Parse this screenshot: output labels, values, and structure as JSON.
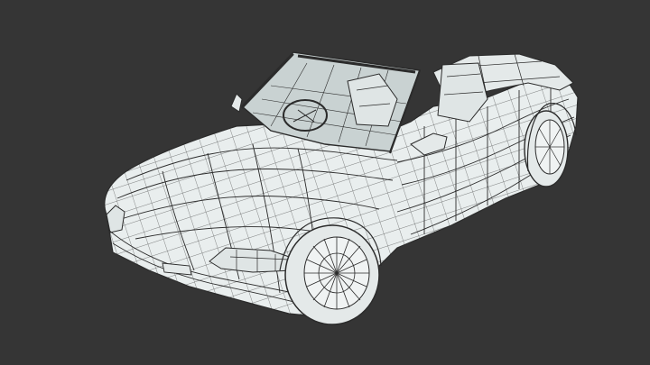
{
  "scene": {
    "background_color": "#353535",
    "mesh_fill_color": "#e9eeee",
    "wire_color": "#2b2b2b",
    "glass_color": "#c9d2d2",
    "interior_color": "#dfe5e5",
    "tire_color": "#e4e9e9"
  }
}
